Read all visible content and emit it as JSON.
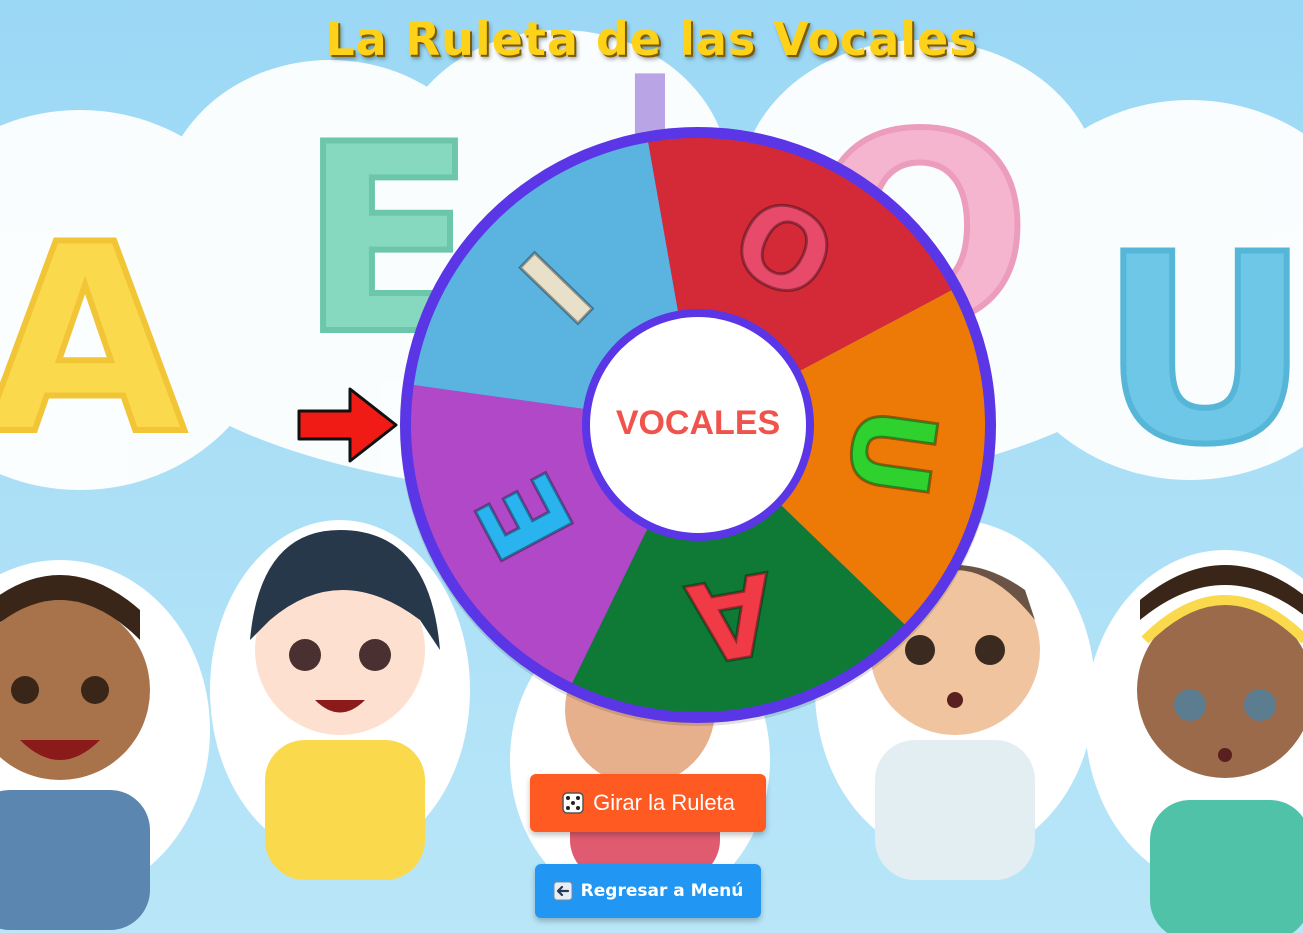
{
  "app": {
    "title": "La Ruleta de las Vocales"
  },
  "wheel": {
    "center_label": "VOCALES",
    "segments": [
      {
        "letter": "O",
        "color": "#d42a38",
        "text_color": "#e84a6a"
      },
      {
        "letter": "U",
        "color": "#ed7a06",
        "text_color": "#2fd12f"
      },
      {
        "letter": "A",
        "color": "#0f7a35",
        "text_color": "#f03a45"
      },
      {
        "letter": "E",
        "color": "#b048c8",
        "text_color": "#29b4f0"
      },
      {
        "letter": "I",
        "color": "#5bb4e0",
        "text_color": "#e8e0c8"
      }
    ],
    "rim_color": "#5a36e6"
  },
  "buttons": {
    "spin_label": "Girar la Ruleta",
    "spin_icon": "dice-icon",
    "back_label": "Regresar a Menú",
    "back_icon": "back-arrow-icon"
  },
  "background": {
    "letters": [
      "A",
      "E",
      "I",
      "O",
      "U"
    ]
  }
}
